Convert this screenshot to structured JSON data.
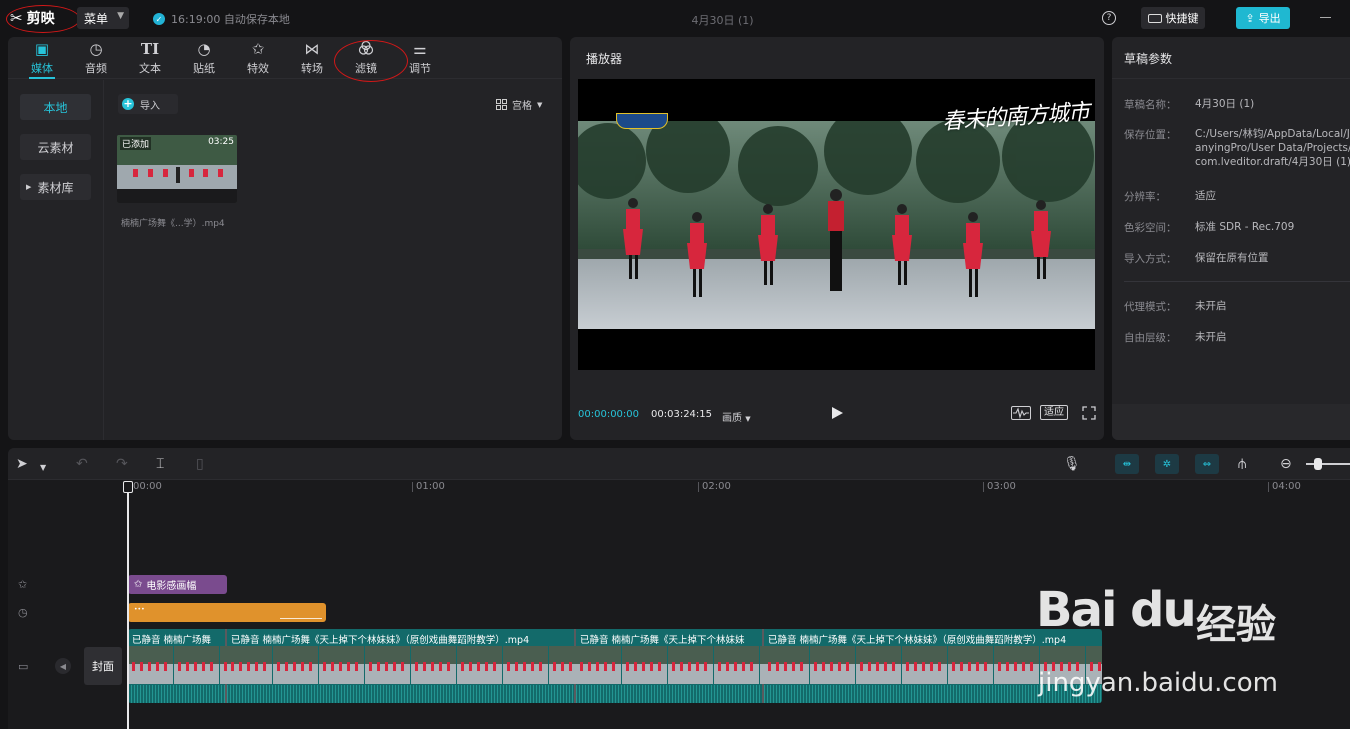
{
  "app": {
    "name": "剪映",
    "menu_label": "菜单",
    "autosave_text": "16:19:00 自动保存本地",
    "document_title": "4月30日 (1)",
    "help_icon": "question-circle-icon",
    "shortcuts_label": "快捷键",
    "export_label": "导出",
    "accent_color": "#27c3d9"
  },
  "media_panel": {
    "tabs": [
      {
        "label": "媒体",
        "icon": "media-icon"
      },
      {
        "label": "音频",
        "icon": "audio-icon"
      },
      {
        "label": "文本",
        "icon": "text-icon"
      },
      {
        "label": "贴纸",
        "icon": "sticker-icon"
      },
      {
        "label": "特效",
        "icon": "effects-icon"
      },
      {
        "label": "转场",
        "icon": "transition-icon"
      },
      {
        "label": "滤镜",
        "icon": "filter-icon"
      },
      {
        "label": "调节",
        "icon": "adjust-icon"
      }
    ],
    "active_tab": "媒体",
    "sidebar": [
      {
        "label": "本地"
      },
      {
        "label": "云素材"
      },
      {
        "label": "素材库"
      }
    ],
    "import_label": "导入",
    "view_label": "宫格",
    "clip": {
      "badge": "已添加",
      "duration": "03:25",
      "name": "楠楠广场舞《...学）.mp4"
    }
  },
  "player": {
    "title": "播放器",
    "overlay_text": "春末的南方城市",
    "current_time": "00:00:00:00",
    "total_time": "00:03:24:15",
    "quality_label": "画质",
    "fit_label": "适应"
  },
  "draft_params": {
    "title": "草稿参数",
    "rows": [
      {
        "key": "草稿名称：",
        "value": "4月30日 (1)"
      },
      {
        "key": "保存位置：",
        "value": "C:/Users/林钧/AppData/Local/JianyingPro/User Data/Projects/com.lveditor.draft/4月30日 (1)"
      },
      {
        "key": "分辨率：",
        "value": "适应"
      },
      {
        "key": "色彩空间：",
        "value": "标准 SDR - Rec.709"
      },
      {
        "key": "导入方式：",
        "value": "保留在原有位置"
      },
      {
        "key": "代理模式：",
        "value": "未开启"
      },
      {
        "key": "自由层级：",
        "value": "未开启"
      }
    ]
  },
  "timeline": {
    "ruler": [
      "00:00",
      "01:00",
      "02:00",
      "03:00",
      "04:00"
    ],
    "effect_clip_label": "电影感画幅",
    "cover_label": "封面",
    "segments": [
      {
        "label": "已静音  楠楠广场舞"
      },
      {
        "label": "已静音     楠楠广场舞《天上掉下个林妹妹》（原创戏曲舞蹈附教学）.mp4"
      },
      {
        "label": "已静音    楠楠广场舞《天上掉下个林妹妹"
      },
      {
        "label": "已静音     楠楠广场舞《天上掉下个林妹妹》（原创戏曲舞蹈附教学）.mp4"
      }
    ]
  },
  "watermark": {
    "logo": "Bai du",
    "logo_cn": "经验",
    "url": "jingyan.baidu.com"
  }
}
